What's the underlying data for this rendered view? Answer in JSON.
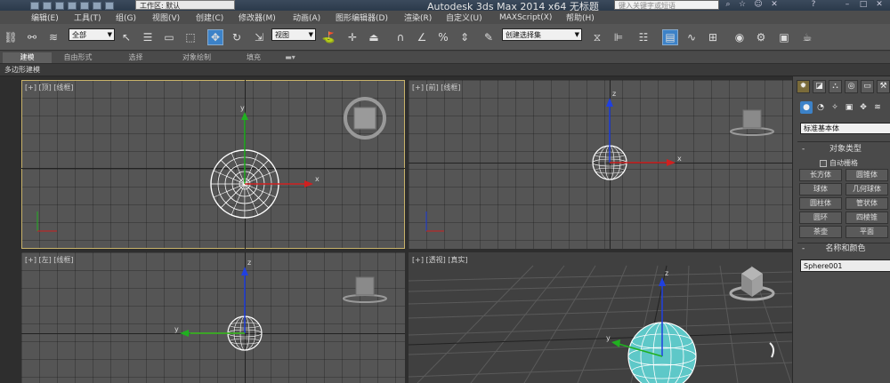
{
  "title_bar": {
    "workspace_label": "工作区: 默认",
    "app_title": "Autodesk 3ds Max  2014 x64      无标题",
    "search_placeholder": "键入关键字或短语"
  },
  "menu": [
    "编辑(E)",
    "工具(T)",
    "组(G)",
    "视图(V)",
    "创建(C)",
    "修改器(M)",
    "动画(A)",
    "图形编辑器(D)",
    "渲染(R)",
    "自定义(U)",
    "MAXScript(X)",
    "帮助(H)"
  ],
  "toolbar": {
    "selection_filter": "全部",
    "reference_coord": "视图",
    "selection_set": "创建选择集"
  },
  "ribbon_tabs": [
    "建模",
    "自由形式",
    "选择",
    "对象绘制",
    "填充"
  ],
  "subbar_label": "多边形建模",
  "viewports": {
    "top": "[+] [顶] [线框]",
    "front": "[+] [前] [线框]",
    "left": "[+] [左] [线框]",
    "perspective": "[+] [透视] [真实]"
  },
  "command_panel": {
    "category": "标准基本体",
    "object_type_title": "对象类型",
    "autogrid_label": "自动栅格",
    "buttons": [
      "长方体",
      "圆锥体",
      "球体",
      "几何球体",
      "圆柱体",
      "管状体",
      "圆环",
      "四棱锥",
      "茶壶",
      "平面"
    ],
    "name_color_title": "名称和颜色",
    "object_name": "Sphere001"
  },
  "colors": {
    "accent_blue": "#3c82c8",
    "active_viewport_border": "#c8b36a",
    "axis_x": "#d02020",
    "axis_y": "#20b020",
    "axis_z": "#2040e0",
    "sphere_real": "#5ec8c8"
  }
}
